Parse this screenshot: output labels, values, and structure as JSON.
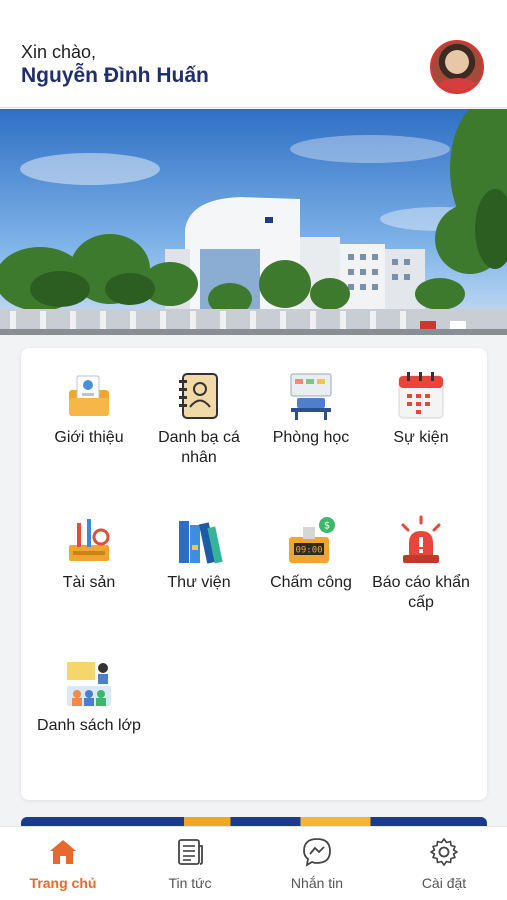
{
  "header": {
    "greeting": "Xin chào,",
    "username": "Nguyễn Đình Huấn"
  },
  "menu": {
    "items": [
      {
        "label": "Giới thiệu",
        "icon": "intro-folder-icon"
      },
      {
        "label": "Danh bạ cá nhân",
        "icon": "contact-book-icon"
      },
      {
        "label": "Phòng học",
        "icon": "classroom-icon"
      },
      {
        "label": "Sự kiện",
        "icon": "calendar-icon"
      },
      {
        "label": "Tài sản",
        "icon": "tools-asset-icon"
      },
      {
        "label": "Thư viện",
        "icon": "books-icon"
      },
      {
        "label": "Chấm công",
        "icon": "time-clock-icon"
      },
      {
        "label": "Báo cáo khẩn cấp",
        "icon": "emergency-siren-icon"
      },
      {
        "label": "Danh sách lớp",
        "icon": "class-list-icon"
      }
    ],
    "clock_text": "09:00"
  },
  "nav": {
    "items": [
      {
        "label": "Trang chủ",
        "icon": "home-icon",
        "active": true
      },
      {
        "label": "Tin tức",
        "icon": "news-icon",
        "active": false
      },
      {
        "label": "Nhắn tin",
        "icon": "messenger-icon",
        "active": false
      },
      {
        "label": "Cài đặt",
        "icon": "gear-icon",
        "active": false
      }
    ]
  },
  "colors": {
    "accent": "#e8682d",
    "username": "#1f2f6e"
  }
}
